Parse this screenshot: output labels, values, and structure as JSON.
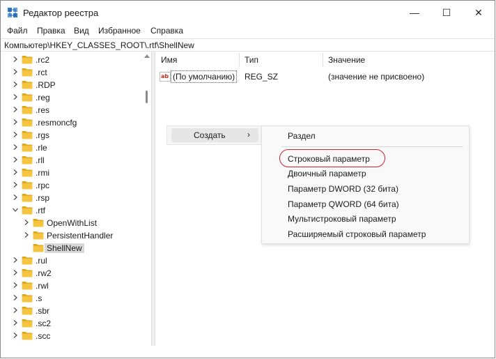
{
  "window": {
    "title": "Редактор реестра",
    "controls": {
      "minimize": "—",
      "maximize": "☐",
      "close": "✕"
    }
  },
  "menu": [
    "Файл",
    "Правка",
    "Вид",
    "Избранное",
    "Справка"
  ],
  "address": "Компьютер\\HKEY_CLASSES_ROOT\\.rtf\\ShellNew",
  "tree": {
    "items": [
      {
        "label": ".rc2",
        "level": 0,
        "expanded": false
      },
      {
        "label": ".rct",
        "level": 0,
        "expanded": false
      },
      {
        "label": ".RDP",
        "level": 0,
        "expanded": false
      },
      {
        "label": ".reg",
        "level": 0,
        "expanded": false
      },
      {
        "label": ".res",
        "level": 0,
        "expanded": false
      },
      {
        "label": ".resmoncfg",
        "level": 0,
        "expanded": false
      },
      {
        "label": ".rgs",
        "level": 0,
        "expanded": false
      },
      {
        "label": ".rle",
        "level": 0,
        "expanded": false
      },
      {
        "label": ".rll",
        "level": 0,
        "expanded": false
      },
      {
        "label": ".rmi",
        "level": 0,
        "expanded": false
      },
      {
        "label": ".rpc",
        "level": 0,
        "expanded": false
      },
      {
        "label": ".rsp",
        "level": 0,
        "expanded": false
      },
      {
        "label": ".rtf",
        "level": 0,
        "expanded": true
      },
      {
        "label": "OpenWithList",
        "level": 1,
        "expanded": false
      },
      {
        "label": "PersistentHandler",
        "level": 1,
        "expanded": false
      },
      {
        "label": "ShellNew",
        "level": 1,
        "expanded": false,
        "selected": true,
        "leaf": true
      },
      {
        "label": ".rul",
        "level": 0,
        "expanded": false
      },
      {
        "label": ".rw2",
        "level": 0,
        "expanded": false
      },
      {
        "label": ".rwl",
        "level": 0,
        "expanded": false
      },
      {
        "label": ".s",
        "level": 0,
        "expanded": false
      },
      {
        "label": ".sbr",
        "level": 0,
        "expanded": false
      },
      {
        "label": ".sc2",
        "level": 0,
        "expanded": false
      },
      {
        "label": ".scc",
        "level": 0,
        "expanded": false
      }
    ]
  },
  "list": {
    "columns": {
      "name": "Имя",
      "type": "Тип",
      "data": "Значение"
    },
    "rows": [
      {
        "name": "(По умолчанию)",
        "type": "REG_SZ",
        "data": "(значение не присвоено)",
        "icon": "ab-string-icon"
      }
    ]
  },
  "context_menu": {
    "parent_label": "Создать",
    "parent_arrow": "›",
    "submenu": {
      "first": "Раздел",
      "items": [
        "Строковый параметр",
        "Двоичный параметр",
        "Параметр DWORD (32 бита)",
        "Параметр QWORD (64 бита)",
        "Мультистроковый параметр",
        "Расширяемый строковый параметр"
      ],
      "highlighted": "Строковый параметр"
    }
  },
  "colors": {
    "folder": "#f5c542",
    "folder_dark": "#e2a91f",
    "highlight_ring": "#d0232b",
    "ab_icon": "#c8301e"
  }
}
